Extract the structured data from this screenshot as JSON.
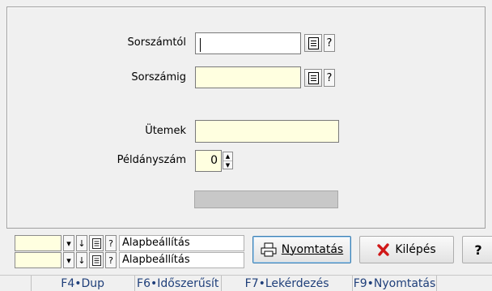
{
  "form": {
    "sorszamtol_label": "Sorszámtól",
    "sorszamig_label": "Sorszámig",
    "utemek_label": "Ütemek",
    "peldanyszam_label": "Példányszám",
    "sorszamtol_value": "",
    "sorszamig_value": "",
    "utemek_value": "",
    "peldanyszam_value": "0",
    "help_mark": "?"
  },
  "presets": {
    "row1_label": "Alapbeállítás",
    "row2_label": "Alapbeállítás",
    "down_glyph": "↓",
    "dropdown_glyph": "▾",
    "help_mark": "?"
  },
  "buttons": {
    "print_label": "Nyomtatás",
    "exit_label": "Kilépés",
    "help_label": "?"
  },
  "statusbar": {
    "f4": "F4•Dup",
    "f6": "F6•Időszerűsít",
    "f7": "F7•Lekérdezés",
    "f9": "F9•Nyomtatás"
  },
  "colors": {
    "input_background": "#ffffe0",
    "exit_icon": "#d01818",
    "function_key_text": "#1f3f7a"
  },
  "icons": {
    "doc": "document-icon",
    "printer": "printer-icon",
    "exit": "x-icon"
  }
}
